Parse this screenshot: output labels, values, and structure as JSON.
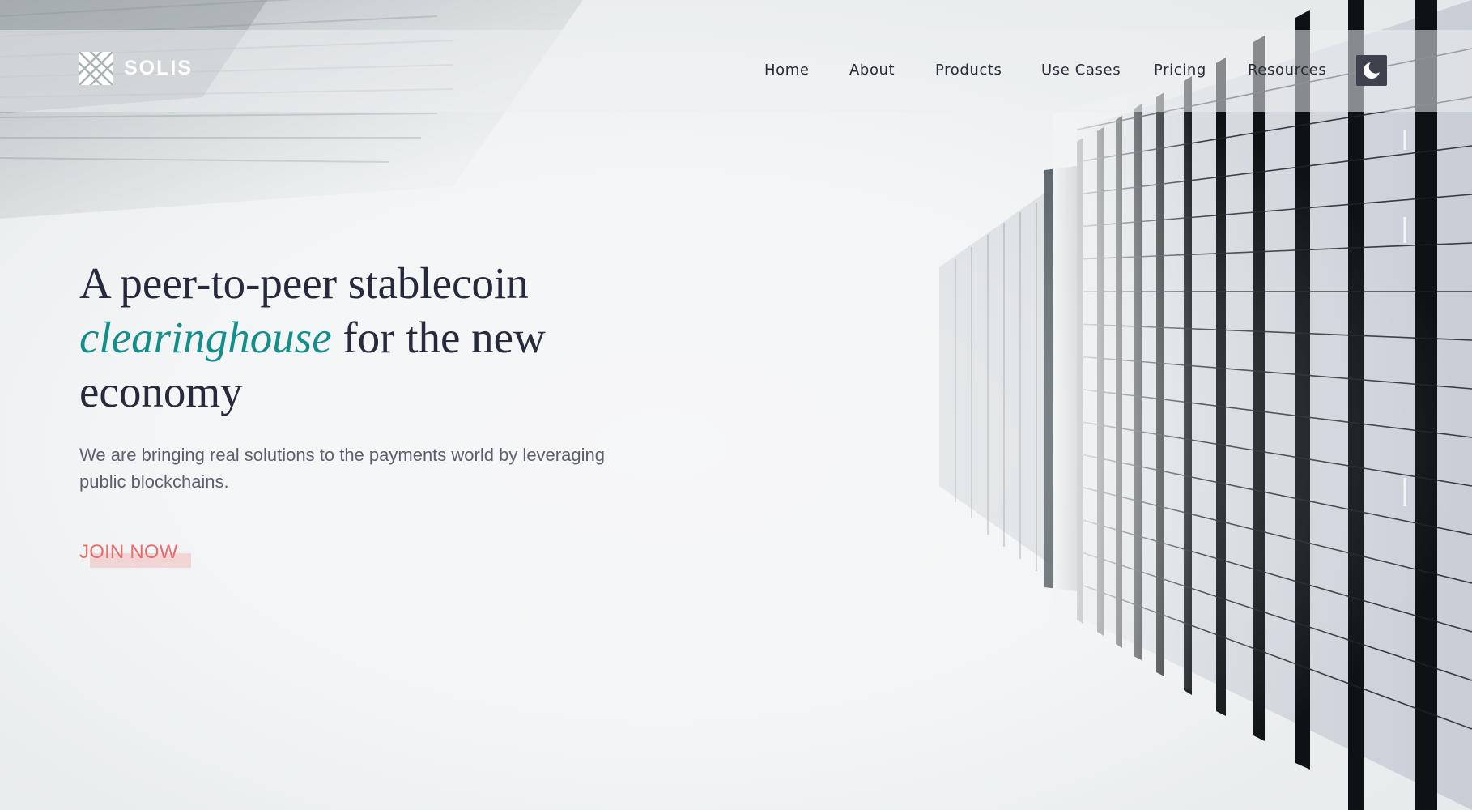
{
  "brand": {
    "name": "SOLIS",
    "logo_icon": "lattice-square-icon"
  },
  "nav": {
    "items": [
      {
        "label": "Home"
      },
      {
        "label": "About"
      },
      {
        "label": "Products"
      },
      {
        "label": "Use Cases"
      },
      {
        "label": "Pricing"
      },
      {
        "label": "Resources"
      }
    ],
    "theme_toggle_icon": "moon-icon"
  },
  "hero": {
    "headline_part1": "A peer-to-peer stablecoin",
    "headline_accent": "clearinghouse",
    "headline_part2": "for the new economy",
    "lead": "We are bringing real solutions to the payments world by leveraging public blockchains.",
    "cta_label": "JOIN NOW"
  },
  "colors": {
    "accent_teal": "#148e8a",
    "cta_coral": "#ec6a6a",
    "heading_navy": "#262a3b",
    "toggle_bg": "#3f414f"
  }
}
